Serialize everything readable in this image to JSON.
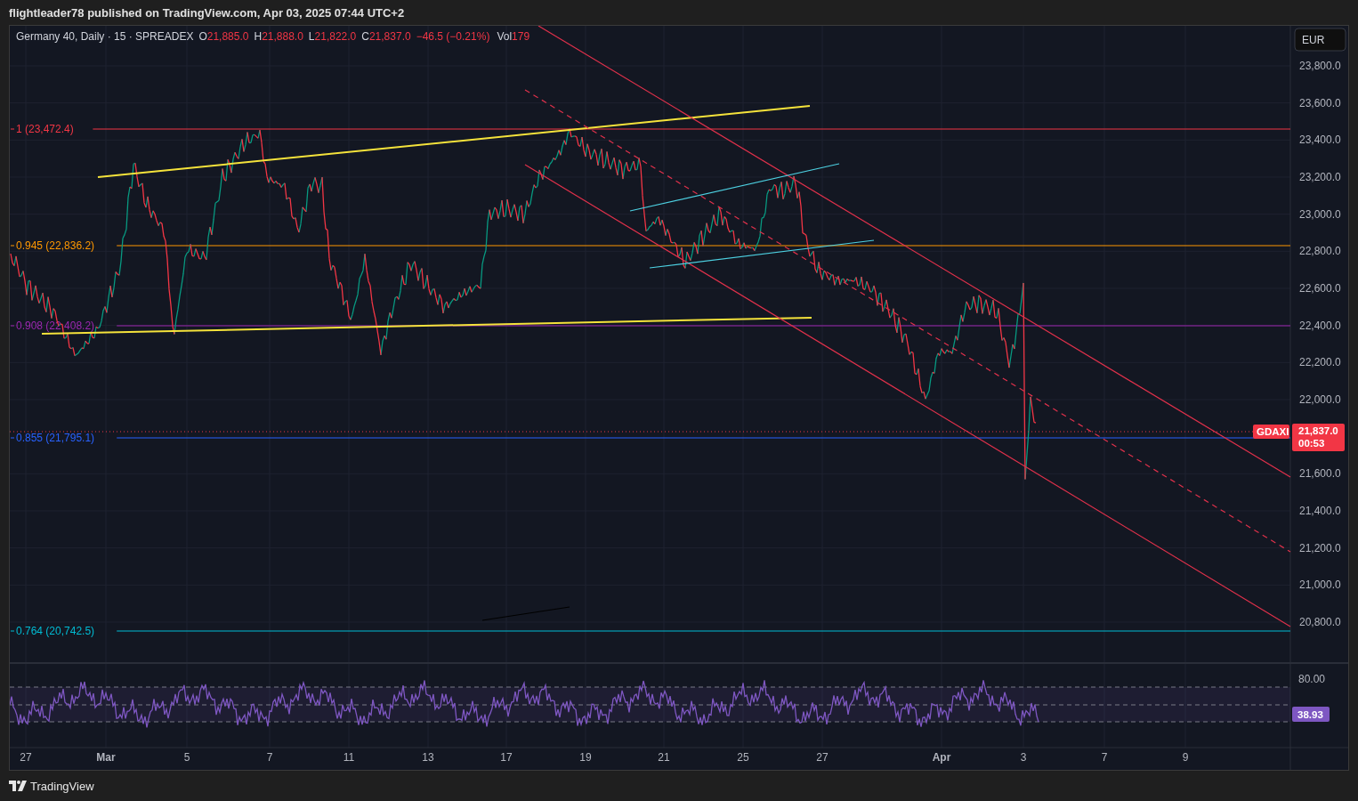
{
  "header": {
    "publisher": "flightleader78 published on TradingView.com, Apr 03, 2025 07:44 UTC+2"
  },
  "legend": {
    "symbol": "Germany 40, Daily · 15 · SPREADEX",
    "values": [
      {
        "key": "O",
        "value": "21,885.0"
      },
      {
        "key": "H",
        "value": "21,888.0"
      },
      {
        "key": "L",
        "value": "21,822.0"
      },
      {
        "key": "C",
        "value": "21,837.0"
      }
    ],
    "change": "−46.5 (−0.21%)",
    "volume": {
      "key": "Vol",
      "value": "179"
    }
  },
  "currency_button": "EUR",
  "fib_levels": [
    {
      "label": "1 (23,472.4)",
      "color": "#f23645"
    },
    {
      "label": "0.945 (22,836.2)",
      "color": "#ff9800"
    },
    {
      "label": "0.908 (22,408.2)",
      "color": "#9c27b0"
    },
    {
      "label": "0.855 (21,795.1)",
      "color": "#2962ff"
    },
    {
      "label": "0.764 (20,742.5)",
      "color": "#00bcd4"
    }
  ],
  "price_axis": {
    "ticks": [
      "23,800.0",
      "23,600.0",
      "23,400.0",
      "23,200.0",
      "23,000.0",
      "22,800.0",
      "22,600.0",
      "22,400.0",
      "22,200.0",
      "22,000.0",
      "21,600.0",
      "21,400.0",
      "21,200.0",
      "21,000.0",
      "20,800.0"
    ],
    "symbol_badge": "GDAXI",
    "last_price": "21,837.0",
    "countdown": "00:53"
  },
  "rsi": {
    "tick": "80.00",
    "value": "38.93"
  },
  "time_axis": [
    {
      "label": "27",
      "kind": "day"
    },
    {
      "label": "Mar",
      "kind": "month"
    },
    {
      "label": "5",
      "kind": "day"
    },
    {
      "label": "7",
      "kind": "day"
    },
    {
      "label": "11",
      "kind": "day"
    },
    {
      "label": "13",
      "kind": "day"
    },
    {
      "label": "17",
      "kind": "day"
    },
    {
      "label": "19",
      "kind": "day"
    },
    {
      "label": "21",
      "kind": "day"
    },
    {
      "label": "25",
      "kind": "day"
    },
    {
      "label": "27",
      "kind": "day"
    },
    {
      "label": "Apr",
      "kind": "month"
    },
    {
      "label": "3",
      "kind": "day"
    },
    {
      "label": "7",
      "kind": "day"
    },
    {
      "label": "9",
      "kind": "day"
    }
  ],
  "footer": {
    "logo_text": "TradingView"
  }
}
